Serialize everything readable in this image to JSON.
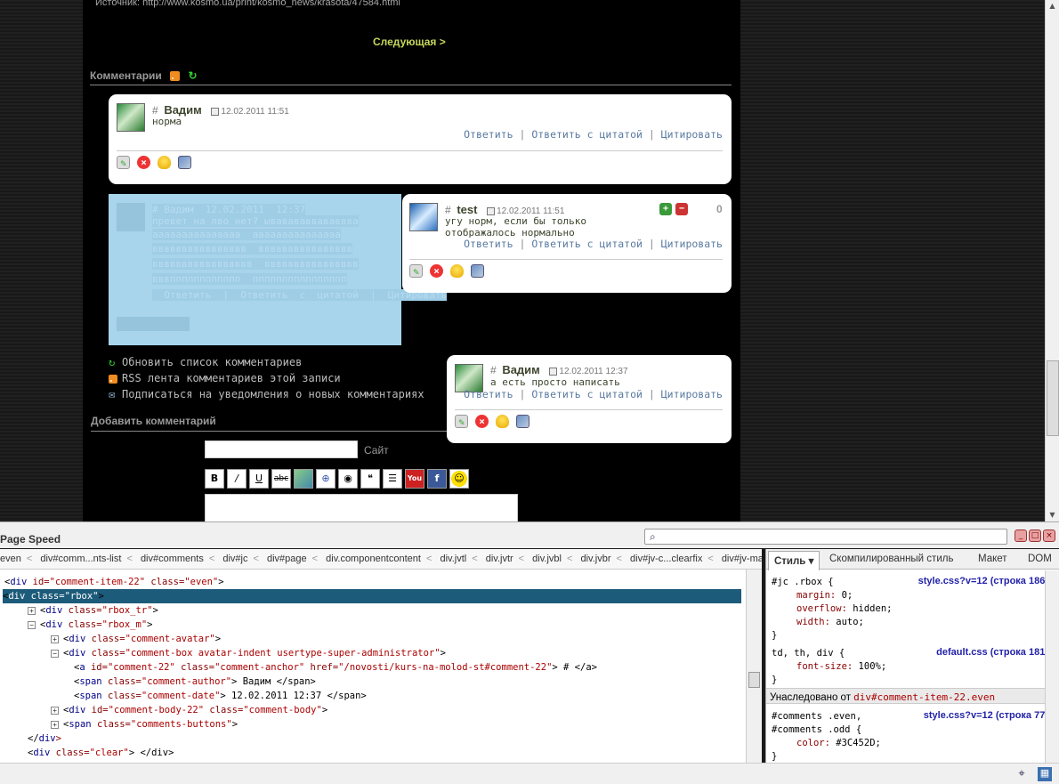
{
  "page": {
    "source_text": "Источник:  http://www.kosmo.ua/print/kosmo_news/krasota/47584.html",
    "next_link": "Следующая  >",
    "comments_heading": "Комментарии",
    "add_comment_heading": "Добавить комментарий",
    "name_placeholder": "",
    "site_label": "Сайт"
  },
  "comments": [
    {
      "hash": "#",
      "author": "Вадим",
      "date": "12.02.2011  11:51",
      "body": "норма",
      "reply": "Ответить",
      "reply_quote": "Ответить  с  цитатой",
      "quote": "Цитировать"
    },
    {
      "hash": "#",
      "author": "test",
      "date": "12.02.2011  11:51",
      "body_lines": [
        "угу норм, если бы только",
        "отображалось нормально"
      ],
      "reply": "Ответить",
      "reply_quote": "Ответить  с  цитатой",
      "quote": "Цитировать",
      "score": "0"
    },
    {
      "hash": "#",
      "author": "Вадим",
      "date": "12.02.2011  12:37",
      "body": "а есть просто написать",
      "reply": "Ответить",
      "reply_quote": "Ответить  с  цитатой",
      "quote": "Цитировать"
    }
  ],
  "selected_comment": {
    "lines": [
      "# Вадим  12.02.2011  12:37",
      "превет на лво нет? ывавававвававвва",
      "ааааааааааааааа  ааааааааааааааа",
      "вввввввввввввввв  вввввввввввввввв",
      "ввввввввввввввввв  вввввввввввввввв",
      "вввпппппппппппп  пппппппппппппппп",
      "  Ответить  |  Ответить  с  цитатой  |  Цитировать"
    ]
  },
  "comment_links": [
    {
      "icon": "refresh-icon",
      "label": "Обновить  список  комментариев"
    },
    {
      "icon": "rss-icon",
      "label": "RSS  лента  комментариев  этой  записи"
    },
    {
      "icon": "mail-icon",
      "label": "Подписаться  на  уведомления  о  новых  комментариях"
    }
  ],
  "format_buttons": [
    "B",
    "I",
    "U",
    "abc",
    "img",
    "lnk",
    "eye",
    "msg",
    "list",
    "You",
    "f",
    "smile"
  ],
  "devtools": {
    "title": "Page Speed",
    "breadcrumbs": [
      "even",
      "div#comm...nts-list",
      "div#comments",
      "div#jc",
      "div#page",
      "div.componentcontent",
      "div.jvtl",
      "div.jvtr",
      "div.jvbl",
      "div.jvbr",
      "div#jv-c...clearfix",
      "div#jv-maincontent"
    ],
    "tree": [
      {
        "indent": 0,
        "tog": "",
        "html": [
          "<",
          "div",
          " id=",
          "\"comment-item-22\"",
          " class=",
          "\"even\"",
          ">"
        ]
      },
      {
        "indent": 0,
        "tog": "",
        "selected": true,
        "html": [
          "<",
          "div",
          " class=",
          "\"rbox\"",
          ">"
        ]
      },
      {
        "indent": 1,
        "tog": "+",
        "html": [
          "<",
          "div",
          " class=",
          "\"rbox_tr\"",
          ">"
        ]
      },
      {
        "indent": 1,
        "tog": "-",
        "html": [
          "<",
          "div",
          " class=",
          "\"rbox_m\"",
          ">"
        ]
      },
      {
        "indent": 2,
        "tog": "+",
        "html": [
          "<",
          "div",
          " class=",
          "\"comment-avatar\"",
          ">"
        ]
      },
      {
        "indent": 2,
        "tog": "-",
        "html": [
          "<",
          "div",
          " class=",
          "\"comment-box avatar-indent usertype-super-administrator\"",
          ">"
        ]
      },
      {
        "indent": 3,
        "tog": "",
        "html": [
          "<",
          "a",
          " id=",
          "\"comment-22\"",
          " class=",
          "\"comment-anchor\"",
          " href=",
          "\"/novosti/kurs-na-molod-st#comment-22\"",
          "> # </a>"
        ]
      },
      {
        "indent": 3,
        "tog": "",
        "html": [
          "<",
          "span",
          " class=",
          "\"comment-author\"",
          "> Вадим </span>"
        ]
      },
      {
        "indent": 3,
        "tog": "",
        "html": [
          "<",
          "span",
          " class=",
          "\"comment-date\"",
          "> 12.02.2011 12:37 </span>"
        ]
      },
      {
        "indent": 2,
        "tog": "+",
        "html": [
          "<",
          "div",
          " id=",
          "\"comment-body-22\"",
          " class=",
          "\"comment-body\"",
          ">"
        ]
      },
      {
        "indent": 2,
        "tog": "+",
        "html": [
          "<",
          "span",
          " class=",
          "\"comments-buttons\"",
          ">"
        ]
      },
      {
        "indent": 1,
        "tog": "",
        "html": [
          "</",
          "div",
          ">",
          "",
          "",
          "",
          ""
        ]
      },
      {
        "indent": 1,
        "tog": "",
        "html": [
          "<",
          "div",
          " class=",
          "\"clear\"",
          "> </div>"
        ]
      }
    ],
    "side_tabs": [
      "Стиль",
      "Скомпилированный стиль",
      "Макет",
      "DOM"
    ],
    "rules": [
      {
        "selector": "#jc .rbox {",
        "props": [
          [
            "margin",
            "0;"
          ],
          [
            "overflow",
            "hidden;"
          ],
          [
            "width",
            "auto;"
          ]
        ],
        "close": "}",
        "src": "style.css?v=12 (строка 186)"
      },
      {
        "selector": "td, th, div {",
        "props": [
          [
            "font-size",
            "100%;"
          ]
        ],
        "close": "}",
        "src": "default.css (строка 181)"
      }
    ],
    "inherited_label": "Унаследовано от",
    "inherited_link": "div#comment-item-22.even",
    "inherited_rule": {
      "selector": "#comments .even,\n#comments .odd {",
      "props": [
        [
          "color",
          "#3C452D;"
        ]
      ],
      "close": "}",
      "src": "style.css?v=12 (строка 77)"
    }
  },
  "colors": {
    "accent_link": "#5a7aa0",
    "next": "#c8d85a",
    "selection": "#1d5b7a"
  }
}
